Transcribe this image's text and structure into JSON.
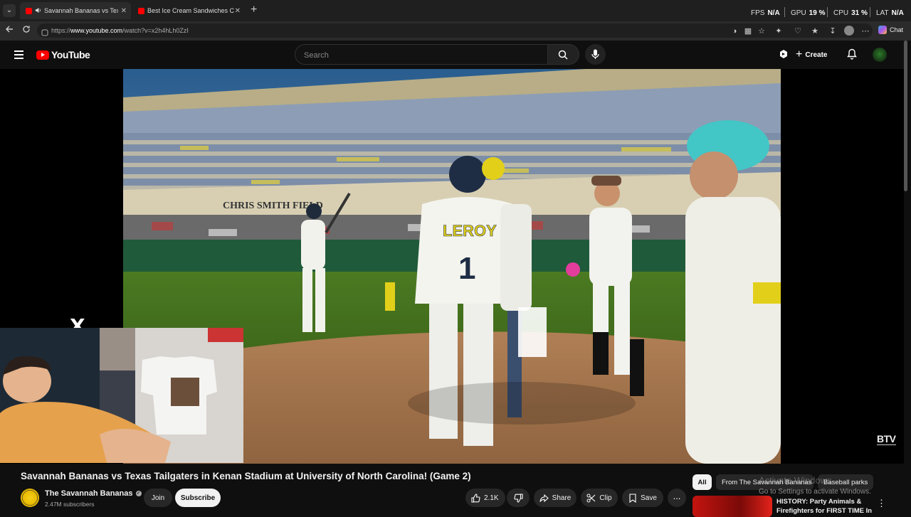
{
  "browser": {
    "tabs": [
      {
        "title": "Savannah Bananas vs Texas Tailgaters in Kenan Stadium",
        "active": true
      },
      {
        "title": "Best Ice Cream Sandwiches Compilation",
        "active": false
      }
    ],
    "url_prefix": "https://",
    "url_host": "www.youtube.com",
    "url_path": "/watch?v=x2h4hLh0ZzI",
    "chat_label": "Chat",
    "hud": {
      "fps_label": "FPS",
      "fps_value": "N/A",
      "gpu_label": "GPU",
      "gpu_value": "19 %",
      "cpu_label": "CPU",
      "cpu_value": "31 %",
      "lat_label": "LAT",
      "lat_value": "N/A"
    }
  },
  "youtube": {
    "logo_text": "YouTube",
    "search_placeholder": "Search",
    "create_label": "Create"
  },
  "video": {
    "title": "Savannah Bananas vs Texas Tailgaters in Kenan Stadium at University of North Carolina! (Game 2)",
    "overlay_logo": "X",
    "watermark": "BTV",
    "scene_sign": "CHRIS SMITH FIELD",
    "jersey_name": "LEROY",
    "jersey_number": "1"
  },
  "channel": {
    "name": "The Savannah Bananas",
    "subscribers": "2.47M subscribers",
    "join_label": "Join",
    "subscribe_label": "Subscribe"
  },
  "actions": {
    "likes": "2.1K",
    "share_label": "Share",
    "clip_label": "Clip",
    "save_label": "Save",
    "more_label": "..."
  },
  "filter_chips": [
    "All",
    "From The Savannah Bananas",
    "Baseball parks"
  ],
  "windows_watermark": {
    "line1": "Activate Windows",
    "line2": "Go to Settings to activate Windows."
  },
  "recommended": [
    {
      "title": "HISTORY: Party Animals & Firefighters for FIRST TIME In"
    }
  ],
  "colors": {
    "youtube_red": "#ff0000",
    "background": "#0f0f0f",
    "bananas_yellow": "#f7d11a"
  }
}
